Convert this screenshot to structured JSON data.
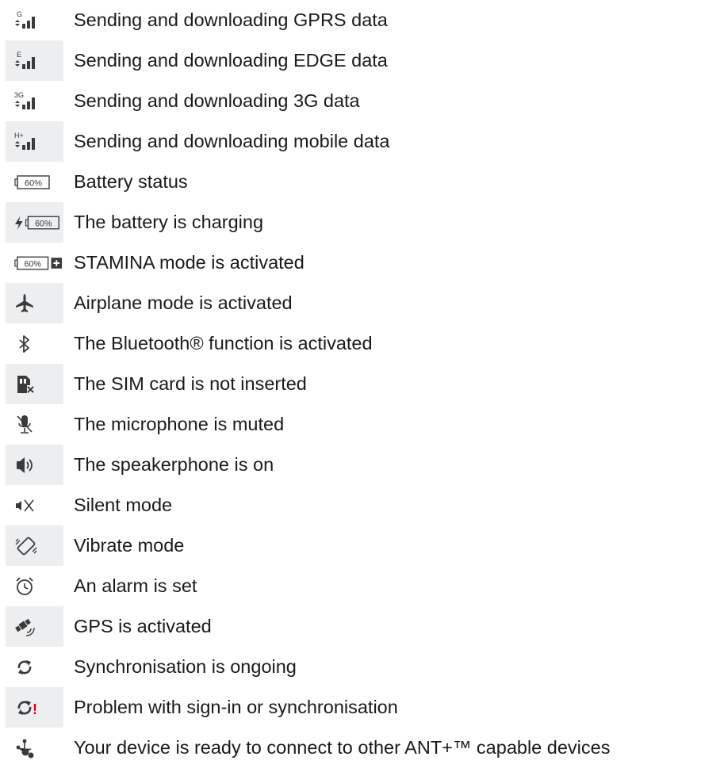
{
  "rows": [
    {
      "icon": "gprs-signal-icon",
      "label": "Sending and downloading GPRS data",
      "shaded": false
    },
    {
      "icon": "edge-signal-icon",
      "label": "Sending and downloading EDGE data",
      "shaded": true
    },
    {
      "icon": "3g-signal-icon",
      "label": "Sending and downloading 3G data",
      "shaded": false
    },
    {
      "icon": "hplus-signal-icon",
      "label": "Sending and downloading mobile data",
      "shaded": true
    },
    {
      "icon": "battery-status-icon",
      "label": "Battery status",
      "shaded": false
    },
    {
      "icon": "battery-charging-icon",
      "label": "The battery is charging",
      "shaded": true
    },
    {
      "icon": "stamina-mode-icon",
      "label": "STAMINA mode is activated",
      "shaded": false
    },
    {
      "icon": "airplane-mode-icon",
      "label": "Airplane mode is activated",
      "shaded": true
    },
    {
      "icon": "bluetooth-icon",
      "label": "The Bluetooth® function is activated",
      "shaded": false
    },
    {
      "icon": "sim-missing-icon",
      "label": "The SIM card is not inserted",
      "shaded": true
    },
    {
      "icon": "microphone-muted-icon",
      "label": "The microphone is muted",
      "shaded": false
    },
    {
      "icon": "speakerphone-icon",
      "label": "The speakerphone is on",
      "shaded": true
    },
    {
      "icon": "silent-mode-icon",
      "label": "Silent mode",
      "shaded": false
    },
    {
      "icon": "vibrate-mode-icon",
      "label": "Vibrate mode",
      "shaded": true
    },
    {
      "icon": "alarm-icon",
      "label": "An alarm is set",
      "shaded": false
    },
    {
      "icon": "gps-icon",
      "label": "GPS is activated",
      "shaded": true
    },
    {
      "icon": "sync-icon",
      "label": "Synchronisation is ongoing",
      "shaded": false
    },
    {
      "icon": "sync-problem-icon",
      "label": "Problem with sign-in or synchronisation",
      "shaded": true
    },
    {
      "icon": "ant-plus-icon",
      "label": "Your device is ready to connect  to other ANT+™ capable devices",
      "shaded": false
    }
  ],
  "icon_text": {
    "gprs": "G",
    "edge": "E",
    "threeg": "3G",
    "hplus": "H+",
    "battery_percent": "60%",
    "sync_problem_mark": "!"
  },
  "colors": {
    "shade": "#eceef0",
    "icon": "#3a3a3a",
    "text": "#1a1a1a",
    "alert": "#e2001a"
  }
}
